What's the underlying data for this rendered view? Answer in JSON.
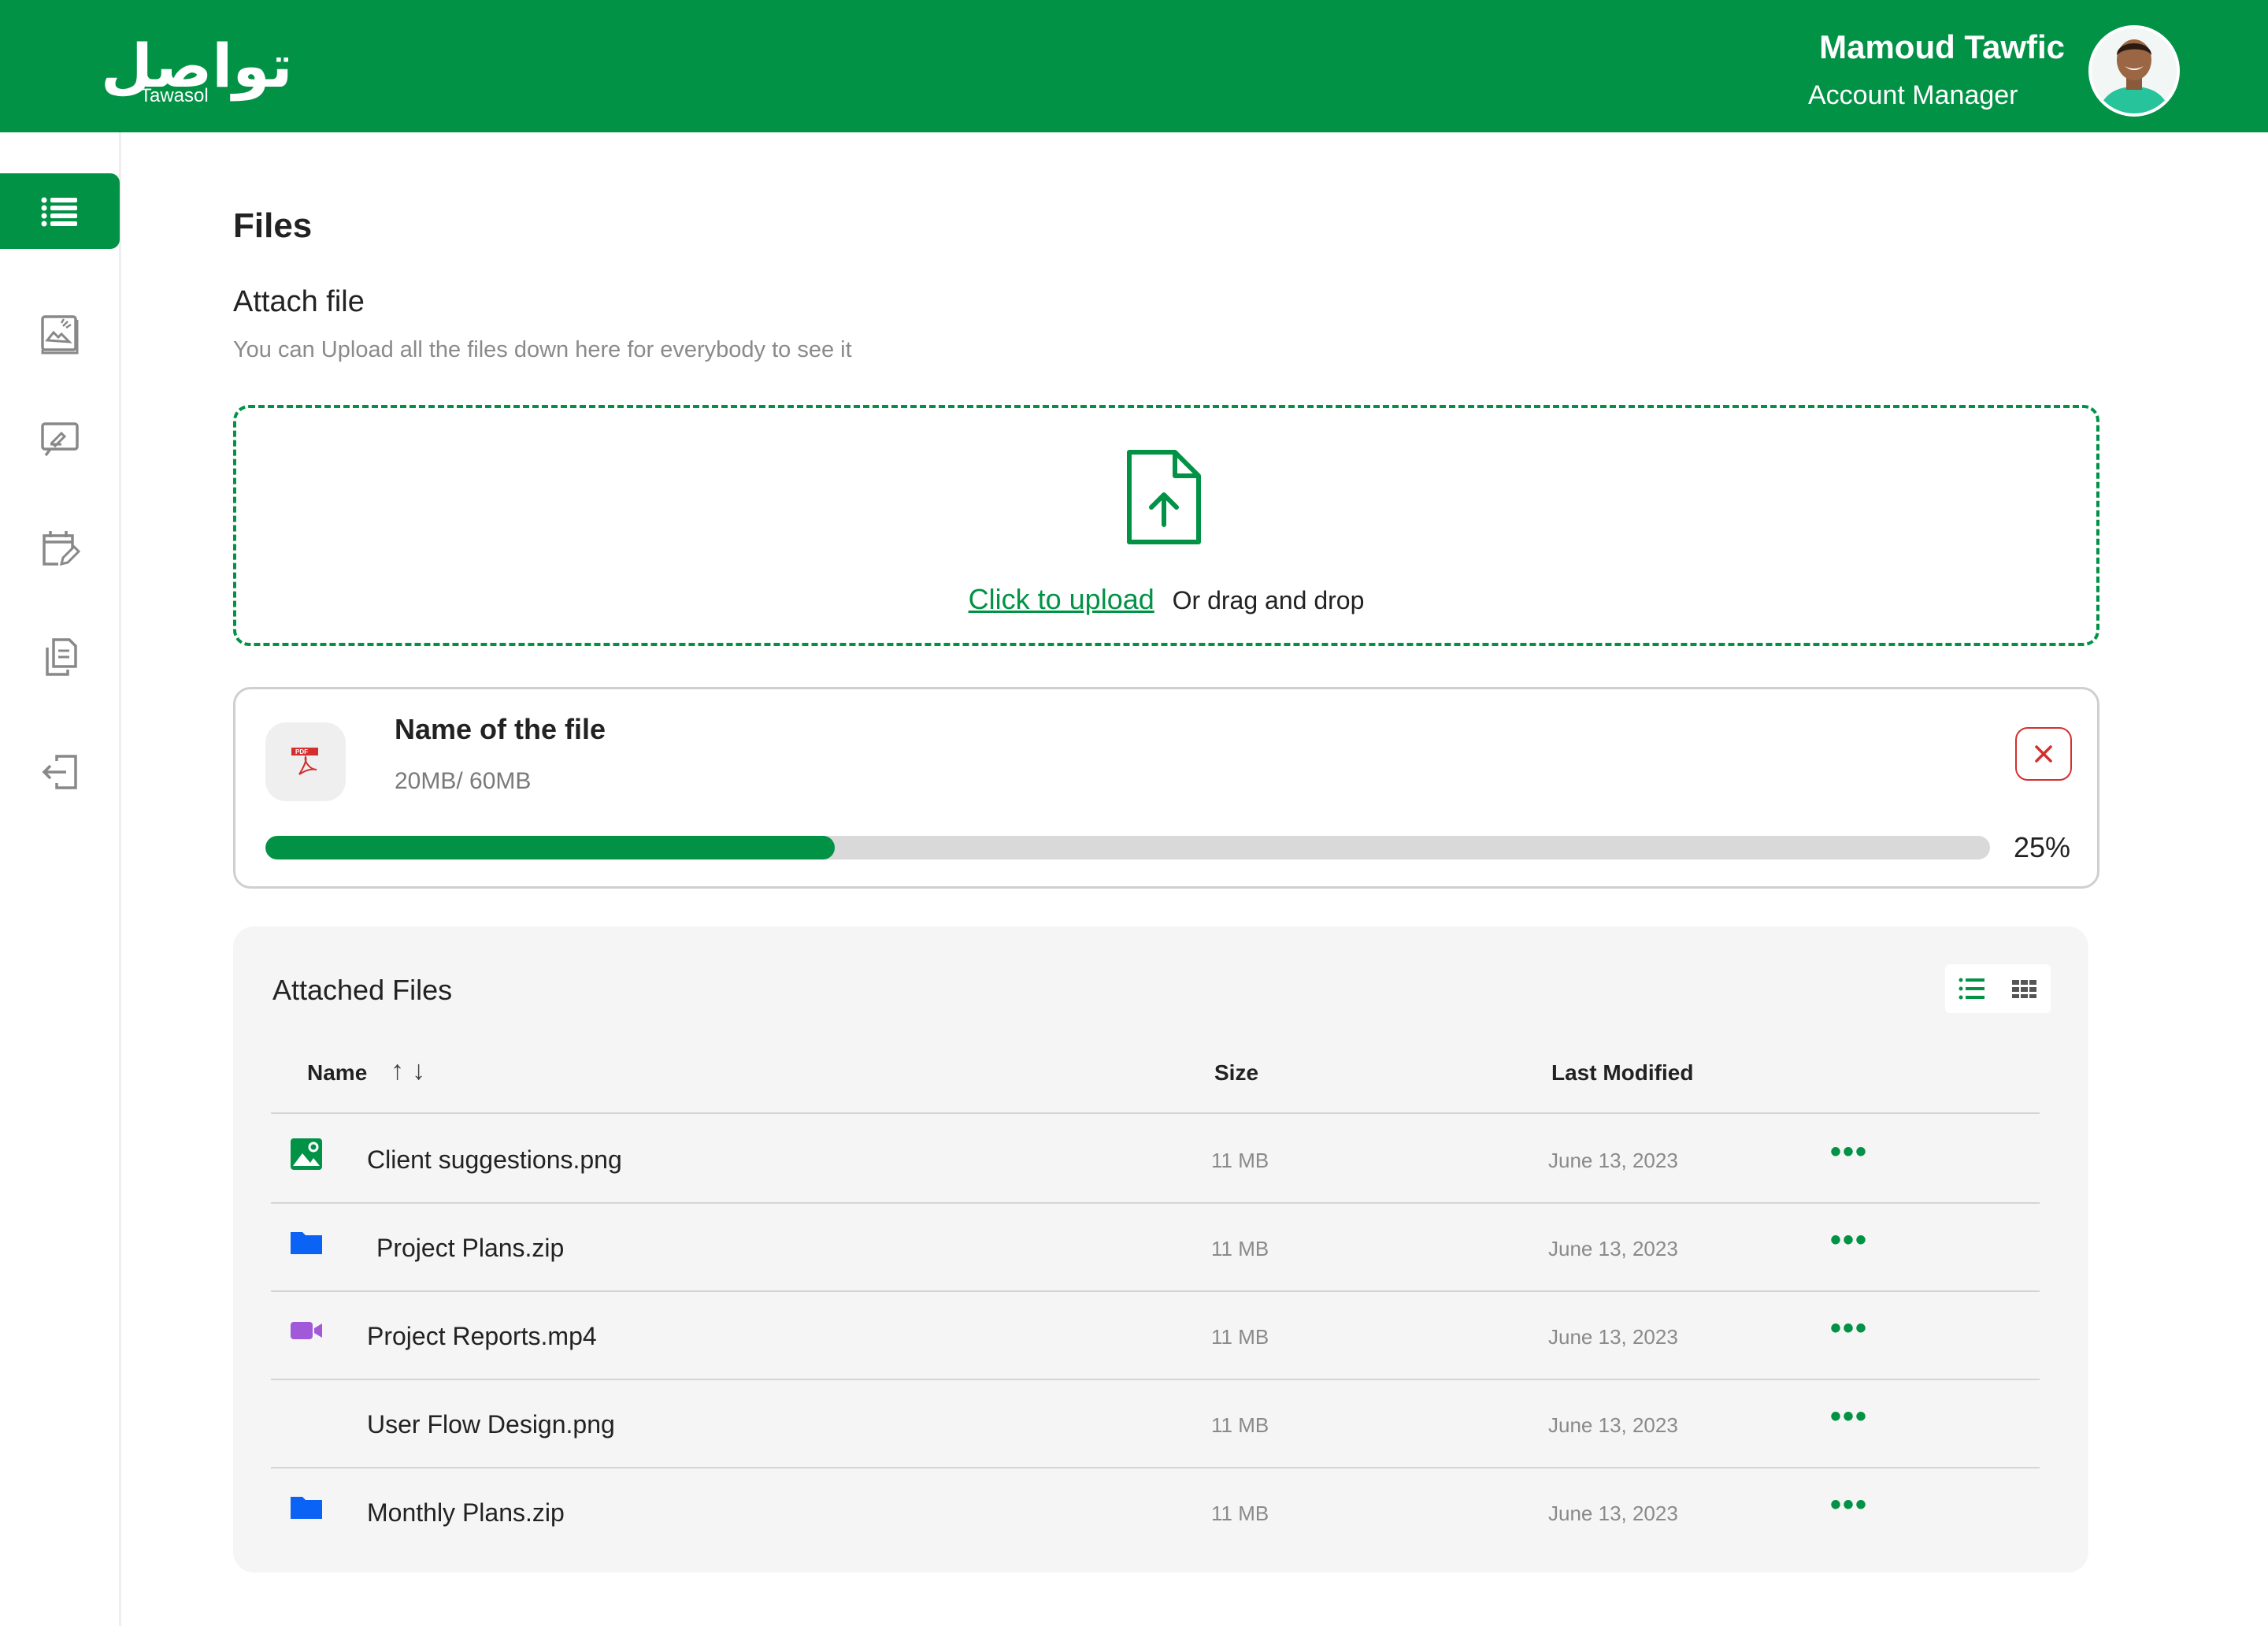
{
  "header": {
    "logo_arabic": "تواصل",
    "logo_english": "Tawasol",
    "user_name": "Mamoud Tawfic",
    "user_role": "Account Manager"
  },
  "sidebar": {
    "items": [
      {
        "icon": "list-icon",
        "active": true
      },
      {
        "icon": "image-edit-icon",
        "active": false
      },
      {
        "icon": "whiteboard-icon",
        "active": false
      },
      {
        "icon": "calendar-edit-icon",
        "active": false
      },
      {
        "icon": "documents-icon",
        "active": false
      },
      {
        "icon": "logout-icon",
        "active": false
      }
    ]
  },
  "page": {
    "title": "Files",
    "attach_title": "Attach file",
    "attach_subtitle": "You can Upload all the files down here for everybody to see it"
  },
  "dropzone": {
    "link": "Click to upload",
    "text": "Or drag and drop"
  },
  "upload": {
    "file_name": "Name of the file",
    "file_size": "20MB/ 60MB",
    "progress": 0.33,
    "progress_label": "25%"
  },
  "attached": {
    "title": "Attached Files",
    "columns": {
      "name": "Name",
      "size": "Size",
      "modified": "Last Modified"
    },
    "rows": [
      {
        "name": "Client suggestions.png",
        "size": "11 MB",
        "date": "June 13, 2023",
        "icon": "image-icon",
        "icon_color": "#029246"
      },
      {
        "name": "Project Plans.zip",
        "size": "11 MB",
        "date": "June 13, 2023",
        "icon": "folder-icon",
        "icon_color": "#0b63f6"
      },
      {
        "name": "Project Reports.mp4",
        "size": "11 MB",
        "date": "June 13, 2023",
        "icon": "video-icon",
        "icon_color": "#a259d9"
      },
      {
        "name": "User Flow Design.png",
        "size": "11 MB",
        "date": "June 13, 2023",
        "icon": "",
        "icon_color": ""
      },
      {
        "name": "Monthly Plans.zip",
        "size": "11 MB",
        "date": "June 13, 2023",
        "icon": "folder-icon",
        "icon_color": "#0b63f6"
      }
    ],
    "more_label": "•••"
  },
  "colors": {
    "brand": "#029246",
    "danger": "#d32f2f",
    "panel_bg": "#f5f5f5"
  }
}
